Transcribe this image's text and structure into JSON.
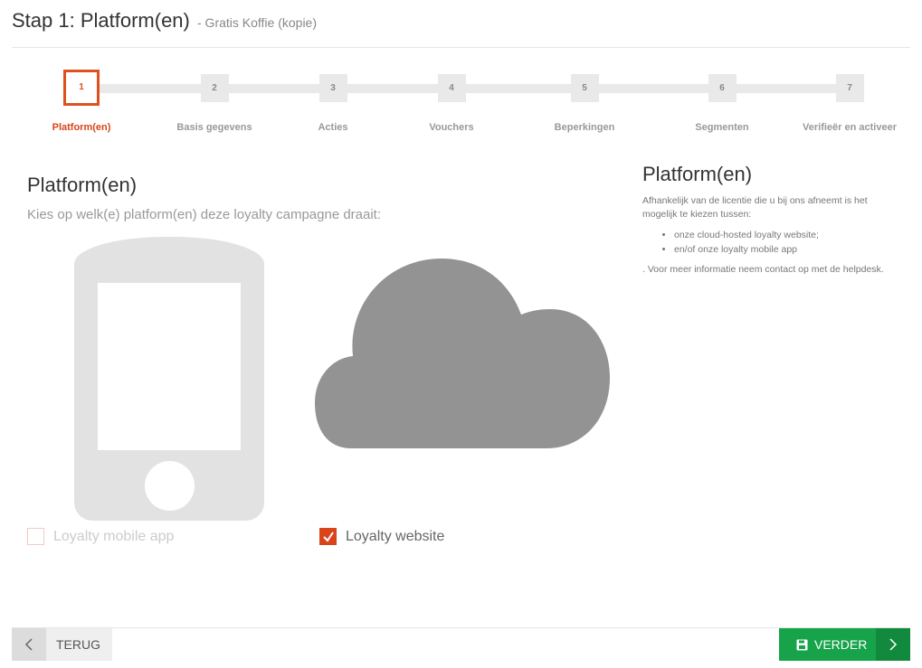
{
  "header": {
    "title": "Stap 1: Platform(en)",
    "subtitle": "- Gratis Koffie (kopie)"
  },
  "wizard": {
    "active_step": 1,
    "steps": [
      {
        "number": "1",
        "label": "Platform(en)"
      },
      {
        "number": "2",
        "label": "Basis gegevens"
      },
      {
        "number": "3",
        "label": "Acties"
      },
      {
        "number": "4",
        "label": "Vouchers"
      },
      {
        "number": "5",
        "label": "Beperkingen"
      },
      {
        "number": "6",
        "label": "Segmenten"
      },
      {
        "number": "7",
        "label": "Verifieër en activeer"
      }
    ]
  },
  "main": {
    "title": "Platform(en)",
    "subtitle": "Kies op welk(e) platform(en) deze loyalty campagne draait:",
    "options": [
      {
        "label": "Loyalty mobile app",
        "checked": false,
        "icon": "mobile-phone-icon"
      },
      {
        "label": "Loyalty website",
        "checked": true,
        "icon": "cloud-icon"
      }
    ]
  },
  "info": {
    "title": "Platform(en)",
    "text": "Afhankelijk van de licentie die u bij ons afneemt is het mogelijk te kiezen tussen:",
    "items": [
      "onze cloud-hosted loyalty website;",
      "en/of onze loyalty mobile app"
    ],
    "note": ". Voor meer informatie neem contact op met de helpdesk."
  },
  "footer": {
    "back_label": "TERUG",
    "next_label": "VERDER"
  },
  "colors": {
    "accent": "#d9441b",
    "success": "#16a34a",
    "muted": "#e9e9e9"
  }
}
